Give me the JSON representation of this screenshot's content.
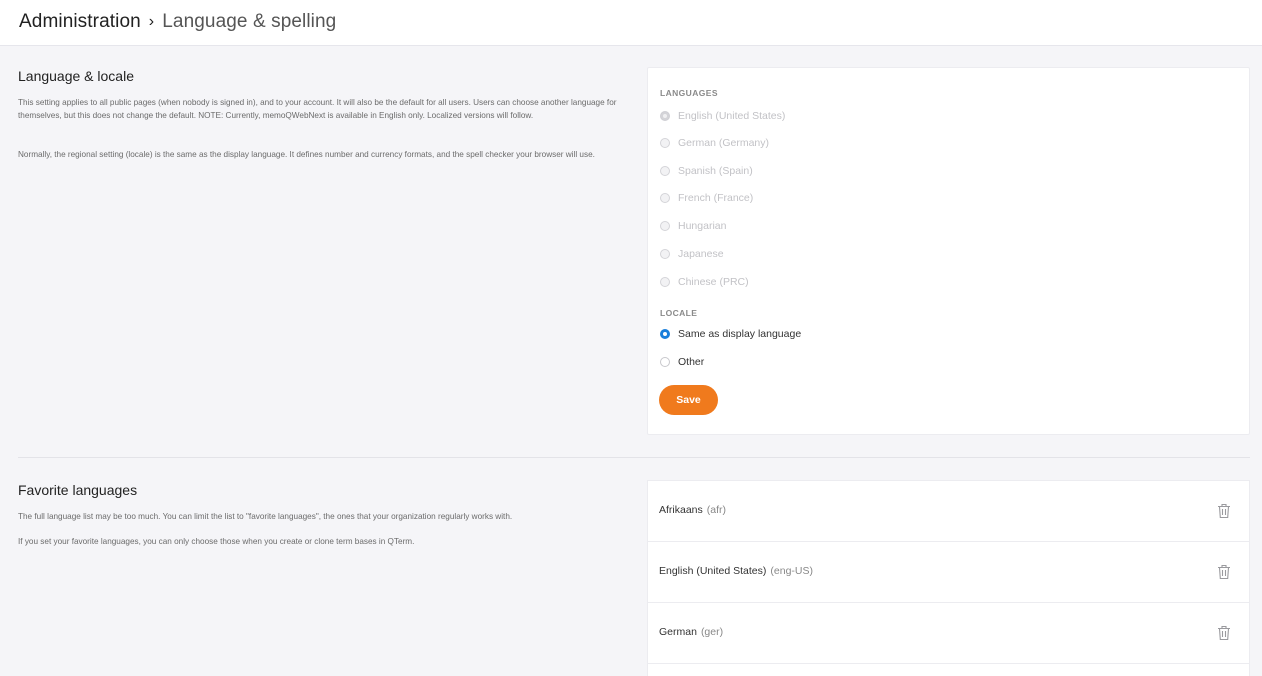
{
  "header": {
    "root": "Administration",
    "separator": "›",
    "current": "Language & spelling"
  },
  "language_section": {
    "title": "Language & locale",
    "desc1": "This setting applies to all public pages (when nobody is signed in), and to your account. It will also be the default for all users. Users can choose another language for themselves, but this does not change the default. NOTE: Currently, memoQWebNext is available in English only. Localized versions will follow.",
    "desc2": "Normally, the regional setting (locale) is the same as the display language. It defines number and currency formats, and the spell checker your browser will use."
  },
  "languages": {
    "label": "LANGUAGES",
    "options": [
      {
        "label": "English (United States)",
        "selected": true
      },
      {
        "label": "German (Germany)",
        "selected": false
      },
      {
        "label": "Spanish (Spain)",
        "selected": false
      },
      {
        "label": "French (France)",
        "selected": false
      },
      {
        "label": "Hungarian",
        "selected": false
      },
      {
        "label": "Japanese",
        "selected": false
      },
      {
        "label": "Chinese (PRC)",
        "selected": false
      }
    ]
  },
  "locale": {
    "label": "LOCALE",
    "options": [
      {
        "label": "Same as display language",
        "selected": true
      },
      {
        "label": "Other",
        "selected": false
      }
    ]
  },
  "save_label": "Save",
  "favorites_section": {
    "title": "Favorite languages",
    "desc1": "The full language list may be too much. You can limit the list to \"favorite languages\", the ones that your organization regularly works with.",
    "desc2": "If you set your favorite languages, you can only choose those when you create or clone term bases in QTerm."
  },
  "favorites": [
    {
      "name": "Afrikaans",
      "code": "(afr)"
    },
    {
      "name": "English (United States)",
      "code": "(eng-US)"
    },
    {
      "name": "German",
      "code": "(ger)"
    }
  ],
  "colors": {
    "accent": "#f07a1d",
    "radio_checked": "#1a7fdb"
  }
}
